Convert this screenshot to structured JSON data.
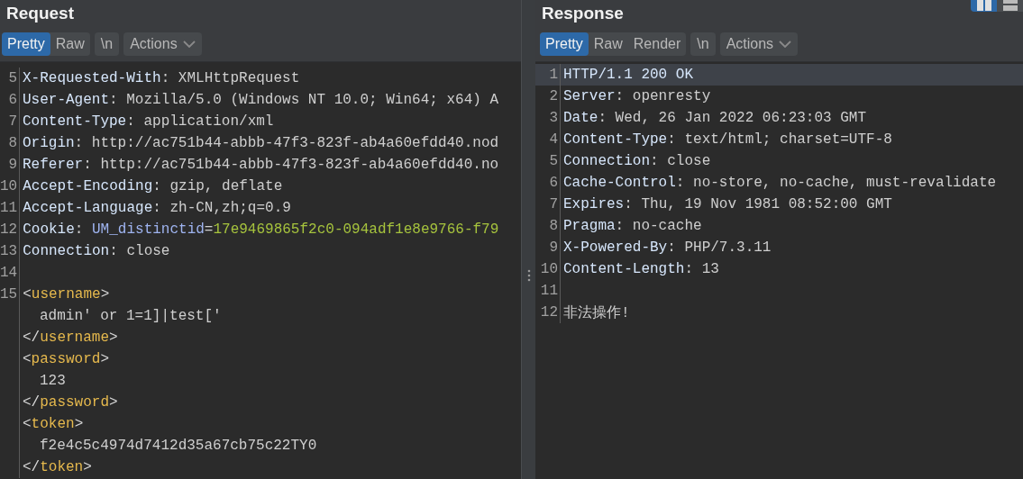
{
  "layout_buttons": [
    {
      "selected": true
    },
    {
      "selected": false
    }
  ],
  "panes": [
    {
      "title": "Request",
      "views": [
        {
          "label": "Pretty",
          "selected": true
        },
        {
          "label": "Raw",
          "selected": false
        }
      ],
      "newline_toggle": "\\n",
      "actions": "Actions",
      "lines": [
        {
          "number": "5",
          "indent": false,
          "highlighted": false,
          "tokens": [
            {
              "kind": "name",
              "text": "X-Requested-With"
            },
            {
              "kind": "value",
              "text": ": XMLHttpRequest"
            }
          ]
        },
        {
          "number": "6",
          "indent": false,
          "highlighted": false,
          "tokens": [
            {
              "kind": "name",
              "text": "User-Agent"
            },
            {
              "kind": "value",
              "text": ": Mozilla/5.0 (Windows NT 10.0; Win64; x64) A"
            }
          ]
        },
        {
          "number": "7",
          "indent": false,
          "highlighted": false,
          "tokens": [
            {
              "kind": "name",
              "text": "Content-Type"
            },
            {
              "kind": "value",
              "text": ": application/xml"
            }
          ]
        },
        {
          "number": "8",
          "indent": false,
          "highlighted": false,
          "tokens": [
            {
              "kind": "name",
              "text": "Origin"
            },
            {
              "kind": "value",
              "text": ": http://ac751b44-abbb-47f3-823f-ab4a60efdd40.nod"
            }
          ]
        },
        {
          "number": "9",
          "indent": false,
          "highlighted": false,
          "tokens": [
            {
              "kind": "name",
              "text": "Referer"
            },
            {
              "kind": "value",
              "text": ": http://ac751b44-abbb-47f3-823f-ab4a60efdd40.no"
            }
          ]
        },
        {
          "number": "10",
          "indent": false,
          "highlighted": false,
          "tokens": [
            {
              "kind": "name",
              "text": "Accept-Encoding"
            },
            {
              "kind": "value",
              "text": ": gzip, deflate"
            }
          ]
        },
        {
          "number": "11",
          "indent": false,
          "highlighted": false,
          "tokens": [
            {
              "kind": "name",
              "text": "Accept-Language"
            },
            {
              "kind": "value",
              "text": ": zh-CN,zh;q=0.9"
            }
          ]
        },
        {
          "number": "12",
          "indent": false,
          "highlighted": false,
          "tokens": [
            {
              "kind": "name",
              "text": "Cookie"
            },
            {
              "kind": "value",
              "text": ": "
            },
            {
              "kind": "param",
              "text": "UM_distinctid"
            },
            {
              "kind": "value",
              "text": "="
            },
            {
              "kind": "param-value",
              "text": "17e9469865f2c0-094adf1e8e9766-f79"
            }
          ]
        },
        {
          "number": "13",
          "indent": false,
          "highlighted": false,
          "tokens": [
            {
              "kind": "name",
              "text": "Connection"
            },
            {
              "kind": "value",
              "text": ": close"
            }
          ]
        },
        {
          "number": "14",
          "indent": false,
          "highlighted": false
        },
        {
          "number": "15",
          "indent": false,
          "highlighted": false,
          "tokens": [
            {
              "kind": "bracket",
              "text": "<"
            },
            {
              "kind": "tag",
              "text": "username"
            },
            {
              "kind": "bracket",
              "text": ">"
            }
          ]
        },
        {
          "indent": true,
          "highlighted": false,
          "tokens": [
            {
              "kind": "value",
              "text": "admin' or 1=1]|test['"
            }
          ]
        },
        {
          "indent": false,
          "highlighted": false,
          "tokens": [
            {
              "kind": "bracket",
              "text": "</"
            },
            {
              "kind": "tag",
              "text": "username"
            },
            {
              "kind": "bracket",
              "text": ">"
            }
          ]
        },
        {
          "indent": false,
          "highlighted": false,
          "tokens": [
            {
              "kind": "bracket",
              "text": "<"
            },
            {
              "kind": "tag",
              "text": "password"
            },
            {
              "kind": "bracket",
              "text": ">"
            }
          ]
        },
        {
          "indent": true,
          "highlighted": false,
          "tokens": [
            {
              "kind": "value",
              "text": "123"
            }
          ]
        },
        {
          "indent": false,
          "highlighted": false,
          "tokens": [
            {
              "kind": "bracket",
              "text": "</"
            },
            {
              "kind": "tag",
              "text": "password"
            },
            {
              "kind": "bracket",
              "text": ">"
            }
          ]
        },
        {
          "indent": false,
          "highlighted": false,
          "tokens": [
            {
              "kind": "bracket",
              "text": "<"
            },
            {
              "kind": "tag",
              "text": "token"
            },
            {
              "kind": "bracket",
              "text": ">"
            }
          ]
        },
        {
          "indent": true,
          "highlighted": false,
          "tokens": [
            {
              "kind": "value",
              "text": "f2e4c5c4974d7412d35a67cb75c22TY0"
            }
          ]
        },
        {
          "indent": false,
          "highlighted": false,
          "tokens": [
            {
              "kind": "bracket",
              "text": "</"
            },
            {
              "kind": "tag",
              "text": "token"
            },
            {
              "kind": "bracket",
              "text": ">"
            }
          ]
        }
      ]
    },
    {
      "title": "Response",
      "views": [
        {
          "label": "Pretty",
          "selected": true
        },
        {
          "label": "Raw",
          "selected": false
        },
        {
          "label": "Render",
          "selected": false
        }
      ],
      "newline_toggle": "\\n",
      "actions": "Actions",
      "lines": [
        {
          "number": "1",
          "indent": false,
          "highlighted": true,
          "tokens": [
            {
              "kind": "name",
              "text": "HTTP/1.1 200 OK"
            }
          ]
        },
        {
          "number": "2",
          "indent": false,
          "highlighted": false,
          "tokens": [
            {
              "kind": "name",
              "text": "Server"
            },
            {
              "kind": "value",
              "text": ": openresty"
            }
          ]
        },
        {
          "number": "3",
          "indent": false,
          "highlighted": false,
          "tokens": [
            {
              "kind": "name",
              "text": "Date"
            },
            {
              "kind": "value",
              "text": ": Wed, 26 Jan 2022 06:23:03 GMT"
            }
          ]
        },
        {
          "number": "4",
          "indent": false,
          "highlighted": false,
          "tokens": [
            {
              "kind": "name",
              "text": "Content-Type"
            },
            {
              "kind": "value",
              "text": ": text/html; charset=UTF-8"
            }
          ]
        },
        {
          "number": "5",
          "indent": false,
          "highlighted": false,
          "tokens": [
            {
              "kind": "name",
              "text": "Connection"
            },
            {
              "kind": "value",
              "text": ": close"
            }
          ]
        },
        {
          "number": "6",
          "indent": false,
          "highlighted": false,
          "tokens": [
            {
              "kind": "name",
              "text": "Cache-Control"
            },
            {
              "kind": "value",
              "text": ": no-store, no-cache, must-revalidate"
            }
          ]
        },
        {
          "number": "7",
          "indent": false,
          "highlighted": false,
          "tokens": [
            {
              "kind": "name",
              "text": "Expires"
            },
            {
              "kind": "value",
              "text": ": Thu, 19 Nov 1981 08:52:00 GMT"
            }
          ]
        },
        {
          "number": "8",
          "indent": false,
          "highlighted": false,
          "tokens": [
            {
              "kind": "name",
              "text": "Pragma"
            },
            {
              "kind": "value",
              "text": ": no-cache"
            }
          ]
        },
        {
          "number": "9",
          "indent": false,
          "highlighted": false,
          "tokens": [
            {
              "kind": "name",
              "text": "X-Powered-By"
            },
            {
              "kind": "value",
              "text": ": PHP/7.3.11"
            }
          ]
        },
        {
          "number": "10",
          "indent": false,
          "highlighted": false,
          "tokens": [
            {
              "kind": "name",
              "text": "Content-Length"
            },
            {
              "kind": "value",
              "text": ": 13"
            }
          ]
        },
        {
          "number": "11",
          "indent": false,
          "highlighted": false
        },
        {
          "number": "12",
          "indent": false,
          "highlighted": false,
          "tokens": [
            {
              "kind": "value",
              "text": "非法操作!"
            }
          ]
        }
      ]
    }
  ]
}
